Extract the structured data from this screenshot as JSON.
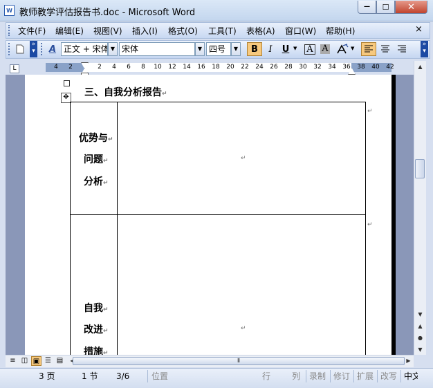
{
  "window": {
    "title": "教师教学评估报告书.doc - Microsoft Word",
    "icon_label": "W",
    "controls": {
      "minimize": "—",
      "maximize": "☐",
      "close": "✕"
    }
  },
  "menu": {
    "items": [
      "文件(F)",
      "编辑(E)",
      "视图(V)",
      "插入(I)",
      "格式(O)",
      "工具(T)",
      "表格(A)",
      "窗口(W)",
      "帮助(H)"
    ],
    "close_doc": "×"
  },
  "toolbar": {
    "style_value": "正文 + 宋体",
    "font_value": "宋体",
    "size_value": "四号",
    "bold": "B",
    "italic": "I",
    "underline": "U",
    "char_border": "A",
    "char_shading": "A",
    "dropdown_arrow": "▼"
  },
  "ruler": {
    "numbers": [
      "4",
      "2",
      "2",
      "4",
      "6",
      "8",
      "10",
      "12",
      "14",
      "16",
      "18",
      "20",
      "22",
      "24",
      "26",
      "28",
      "30",
      "32",
      "34",
      "36",
      "38",
      "40",
      "42"
    ],
    "tab_selector": "L"
  },
  "document": {
    "heading": "三、自我分析报告",
    "row1_lines": [
      "优势与",
      "问题",
      "分析"
    ],
    "row2_lines": [
      "自我",
      "改进",
      "措施"
    ],
    "para_mark": "↵",
    "move_handle": "✥"
  },
  "statusbar": {
    "page": "3 页",
    "section": "1 节",
    "page_of": "3/6",
    "position": "位置",
    "line": "行",
    "column": "列",
    "rec": "录制",
    "trk": "修订",
    "ext": "扩展",
    "ovr": "改写",
    "lang": "中文"
  }
}
